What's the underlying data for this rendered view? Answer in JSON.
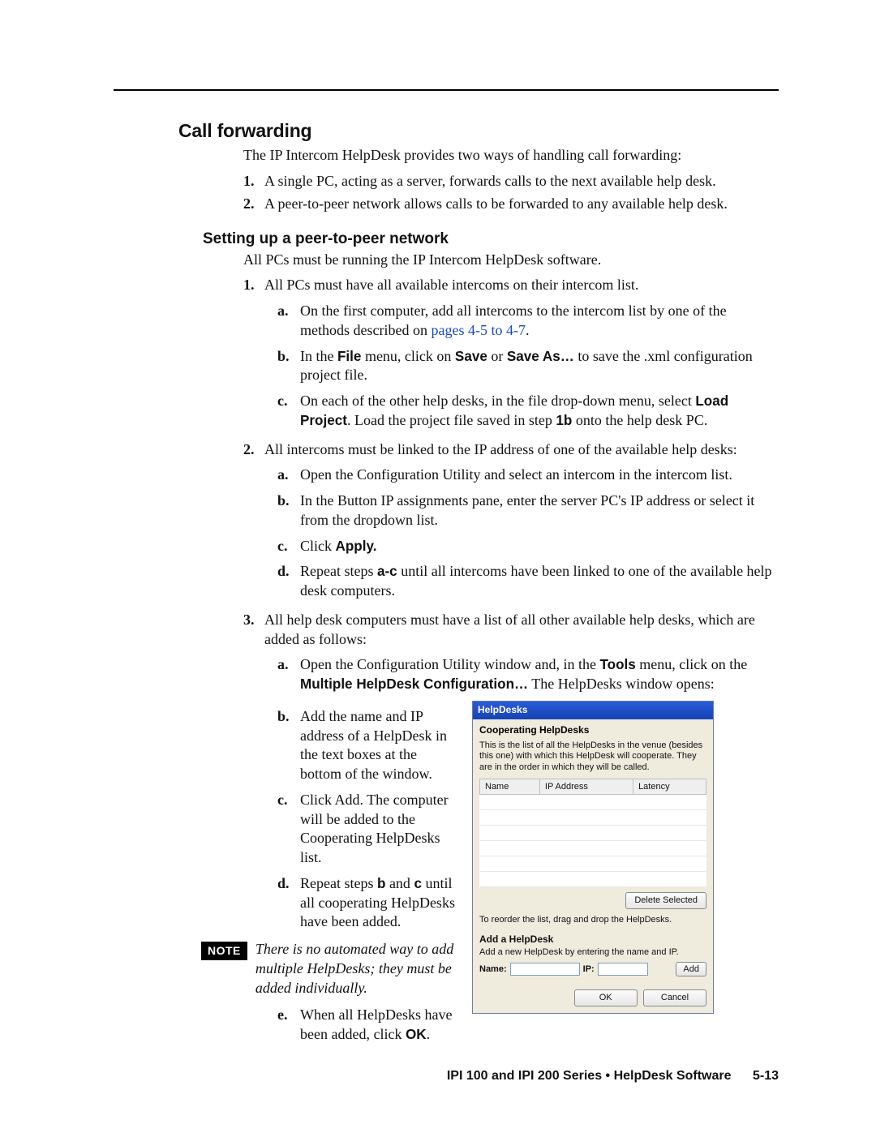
{
  "section_title": "Call forwarding",
  "lead": "The IP Intercom HelpDesk provides two ways of handling call forwarding:",
  "ways": [
    "A single PC, acting as a server, forwards calls to the next available help desk.",
    "A peer-to-peer network allows calls to be forwarded to any available help desk."
  ],
  "subhead": "Setting up a peer-to-peer network",
  "sublead": "All PCs must be running the IP Intercom HelpDesk software.",
  "steps": {
    "1": {
      "text": "All PCs must have all available intercoms on their intercom list.",
      "a_pre": "On the first computer, add all intercoms to the intercom list by one of the methods described on ",
      "a_link": "pages 4-5 to 4-7",
      "a_post": ".",
      "b_pre": "In the ",
      "b_file": "File",
      "b_mid1": " menu, click on ",
      "b_save": "Save",
      "b_mid2": " or ",
      "b_saveas": "Save As…",
      "b_post": " to save the .xml configuration project file.",
      "c_pre": "On each of the other help desks, in the file drop-down menu, select ",
      "c_load": "Load Project",
      "c_mid": ".  Load the project file saved in step ",
      "c_ref": "1b",
      "c_post": " onto the help desk PC."
    },
    "2": {
      "text": "All intercoms must be linked to the IP address of one of the available help desks:",
      "a": "Open the Configuration Utility and select an intercom in the intercom list.",
      "b": "In the Button IP assignments pane, enter the server PC's IP address or select it from the dropdown list.",
      "c_pre": "Click ",
      "c_apply": "Apply.",
      "d_pre": "Repeat steps ",
      "d_ref": "a-c",
      "d_post": " until all intercoms have been linked to one of the available help desk computers."
    },
    "3": {
      "text": "All help desk computers must have a list of all other available help desks, which are added as follows:",
      "a_pre": "Open the Configuration Utility window and, in the ",
      "a_tools": "Tools",
      "a_mid": " menu, click on the ",
      "a_mhc": "Multiple HelpDesk Configuration…",
      "a_post": " The HelpDesks window opens:",
      "b": "Add the name and IP address of a HelpDesk in the text boxes at the bottom of the window.",
      "c": "Click Add.  The computer will be added to the Cooperating HelpDesks list.",
      "d_pre": "Repeat steps ",
      "d_b": "b",
      "d_and": " and ",
      "d_c": "c",
      "d_post": " until all cooperating HelpDesks have been added.",
      "note_label": "NOTE",
      "note": "There is no automated way to add multiple HelpDesks; they must be added individually.",
      "e_pre": "When all HelpDesks have been added, click ",
      "e_ok": "OK",
      "e_post": "."
    }
  },
  "dialog": {
    "title": "HelpDesks",
    "group_title": "Cooperating HelpDesks",
    "group_desc": "This is the list of all the HelpDesks in the venue (besides this one) with which this HelpDesk will cooperate.  They are in the order in which they will be called.",
    "cols": {
      "name": "Name",
      "ip": "IP Address",
      "latency": "Latency"
    },
    "delete_btn": "Delete Selected",
    "reorder_note": "To reorder the list, drag and drop the HelpDesks.",
    "add_title": "Add a HelpDesk",
    "add_desc": "Add a new HelpDesk by entering the name and IP.",
    "labels": {
      "name": "Name:",
      "ip": "IP:"
    },
    "add_btn": "Add",
    "ok_btn": "OK",
    "cancel_btn": "Cancel"
  },
  "footer": {
    "text": "IPI 100 and IPI 200 Series • HelpDesk Software",
    "page": "5-13"
  }
}
